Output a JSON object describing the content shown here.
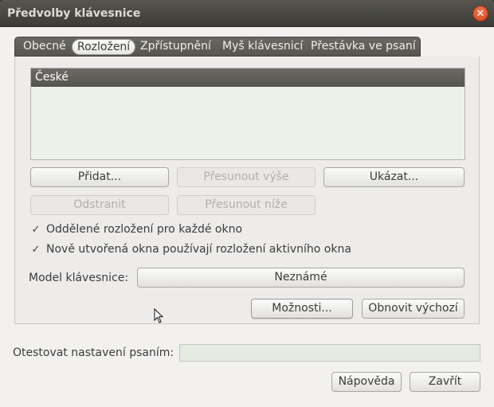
{
  "window": {
    "title": "Předvolby klávesnice"
  },
  "tabs": [
    {
      "label": "Obecné"
    },
    {
      "label": "Rozložení",
      "active": true
    },
    {
      "label": "Zpřístupnění"
    },
    {
      "label": "Myš klávesnicí"
    },
    {
      "label": "Přestávka ve psaní"
    }
  ],
  "layouts": {
    "items": [
      "České"
    ]
  },
  "buttons": {
    "add": "Přidat...",
    "move_up": "Přesunout výše",
    "show": "Ukázat...",
    "remove": "Odstranit",
    "move_down": "Přesunout níže",
    "options": "Možnosti...",
    "reset": "Obnovit výchozí",
    "help": "Nápověda",
    "close": "Zavřít"
  },
  "options": {
    "separate_layout": {
      "label": "Oddělené rozložení pro každé okno",
      "checked": true
    },
    "new_windows_active": {
      "label": "Nově utvořená okna používají rozložení aktivního okna",
      "checked": true
    }
  },
  "model": {
    "label": "Model klávesnice:",
    "value": "Neznámé"
  },
  "test": {
    "label": "Otestovat nastavení psaním:",
    "value": ""
  },
  "icons": {
    "close": "close-icon",
    "check": "checkmark-icon",
    "cursor": "mouse-pointer-icon"
  }
}
